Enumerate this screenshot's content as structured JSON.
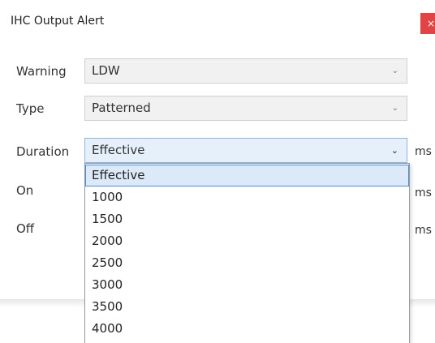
{
  "dialog": {
    "title": "IHC Output Alert",
    "close_glyph": "×"
  },
  "fields": {
    "warning": {
      "label": "Warning",
      "value": "LDW"
    },
    "type": {
      "label": "Type",
      "value": "Patterned"
    },
    "duration": {
      "label": "Duration",
      "value": "Effective",
      "unit": "ms"
    },
    "on": {
      "label": "On",
      "unit": "ms"
    },
    "off": {
      "label": "Off",
      "unit": "ms"
    }
  },
  "duration_options": [
    "Effective",
    "1000",
    "1500",
    "2000",
    "2500",
    "3000",
    "3500",
    "4000"
  ],
  "icons": {
    "dropdown": "chevron-down-icon",
    "close": "close-icon"
  },
  "colors": {
    "close_bg": "#e04444",
    "active_select_bg": "#e6f0fa",
    "selected_option_border": "#4a90d9"
  }
}
